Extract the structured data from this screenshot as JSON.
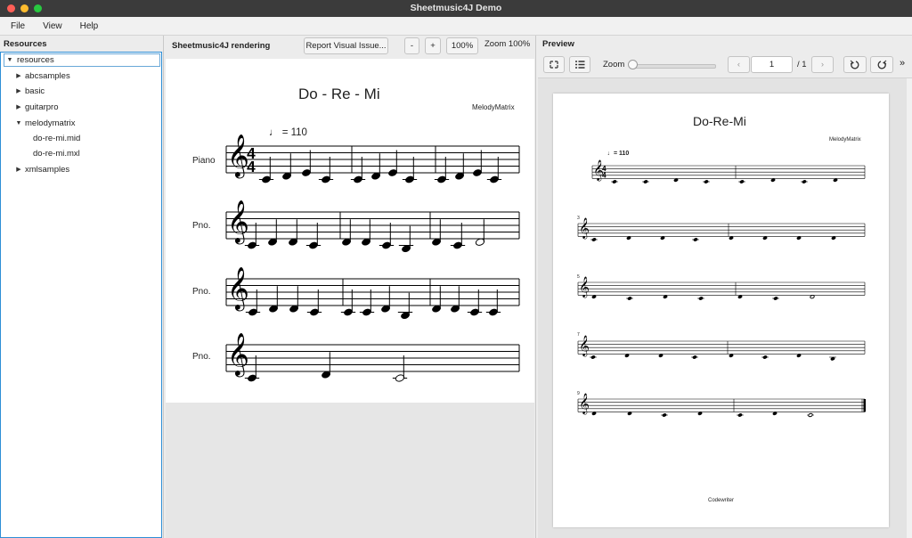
{
  "window": {
    "title": "Sheetmusic4J Demo"
  },
  "menu": [
    "File",
    "View",
    "Help"
  ],
  "resources": {
    "title": "Resources",
    "items": [
      {
        "label": "resources",
        "level": 0,
        "expanded": true
      },
      {
        "label": "abcsamples",
        "level": 1,
        "expanded": false
      },
      {
        "label": "basic",
        "level": 1,
        "expanded": false
      },
      {
        "label": "guitarpro",
        "level": 1,
        "expanded": false
      },
      {
        "label": "melodymatrix",
        "level": 1,
        "expanded": true
      },
      {
        "label": "do-re-mi.mid",
        "level": 2
      },
      {
        "label": "do-re-mi.mxl",
        "level": 2
      },
      {
        "label": "xmlsamples",
        "level": 1,
        "expanded": false
      }
    ]
  },
  "rendering": {
    "title": "Sheetmusic4J rendering",
    "report_button": "Report Visual Issue...",
    "zoom_out": "-",
    "zoom_in": "+",
    "zoom_reset": "100%",
    "zoom_label": "Zoom 100%",
    "score": {
      "title": "Do - Re - Mi",
      "composer": "MelodyMatrix",
      "tempo": "= 110",
      "first_instrument": "Piano",
      "other_instrument": "Pno."
    }
  },
  "preview": {
    "title": "Preview",
    "zoom_label": "Zoom",
    "zoom_level": 0,
    "page_current": "1",
    "page_total": "/ 1",
    "score": {
      "title": "Do-Re-Mi",
      "composer": "MelodyMatrix",
      "tempo": "= 110",
      "measure_numbers": [
        "3",
        "5",
        "7",
        "9"
      ],
      "footer": "Codewriter"
    }
  }
}
